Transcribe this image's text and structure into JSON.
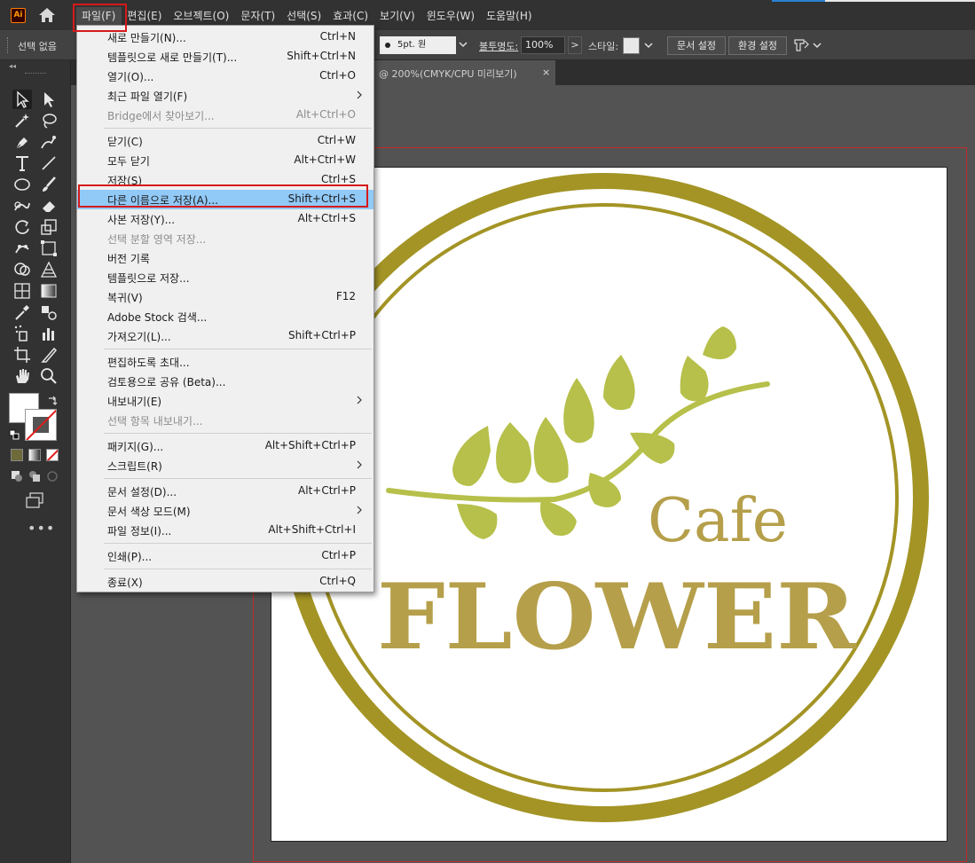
{
  "menubar": {
    "app_logo": "Ai",
    "items": [
      {
        "label": "파일(F)",
        "open": true
      },
      {
        "label": "편집(E)"
      },
      {
        "label": "오브젝트(O)"
      },
      {
        "label": "문자(T)"
      },
      {
        "label": "선택(S)"
      },
      {
        "label": "효과(C)"
      },
      {
        "label": "보기(V)"
      },
      {
        "label": "윈도우(W)"
      },
      {
        "label": "도움말(H)"
      }
    ]
  },
  "controlbar": {
    "selection_label": "선택 없음",
    "stroke_value": "5pt. 원",
    "opacity_label": "불투명도:",
    "opacity_value": "100%",
    "opacity_arrow": ">",
    "style_label": "스타일:",
    "doc_setup_label": "문서 설정",
    "preferences_label": "환경 설정"
  },
  "toolbar": {
    "collapse_glyph": "◂◂",
    "more_glyph": "•••",
    "tools": [
      "selection-tool-icon",
      "direct-selection-tool-icon",
      "magic-wand-tool-icon",
      "lasso-tool-icon",
      "pen-tool-icon",
      "curvature-tool-icon",
      "type-tool-icon",
      "line-segment-tool-icon",
      "ellipse-tool-icon",
      "paintbrush-tool-icon",
      "shaper-tool-icon",
      "eraser-tool-icon",
      "rotate-tool-icon",
      "scale-tool-icon",
      "puppet-warp-tool-icon",
      "free-transform-tool-icon",
      "shape-builder-tool-icon",
      "perspective-grid-tool-icon",
      "mesh-tool-icon",
      "gradient-tool-icon",
      "eyedropper-tool-icon",
      "blend-tool-icon",
      "symbol-sprayer-tool-icon",
      "column-graph-tool-icon",
      "artboard-tool-icon",
      "slice-tool-icon",
      "hand-tool-icon",
      "zoom-tool-icon"
    ]
  },
  "document_tab": {
    "title": "@ 200%(CMYK/CPU 미리보기)",
    "close": "×"
  },
  "artwork": {
    "word_small": "Cafe",
    "word_large": "FLOWER",
    "colors": {
      "ring": "#a39425",
      "leaf": "#b6c04a",
      "text": "#b59f4a"
    }
  },
  "file_menu": {
    "items": [
      {
        "label": "새로 만들기(N)...",
        "shortcut": "Ctrl+N"
      },
      {
        "label": "템플릿으로 새로 만들기(T)...",
        "shortcut": "Shift+Ctrl+N"
      },
      {
        "label": "열기(O)...",
        "shortcut": "Ctrl+O"
      },
      {
        "label": "최근 파일 열기(F)",
        "shortcut": "",
        "submenu": true
      },
      {
        "label": "Bridge에서 찾아보기...",
        "shortcut": "Alt+Ctrl+O",
        "disabled": true
      },
      {
        "label": "닫기(C)",
        "shortcut": "Ctrl+W"
      },
      {
        "label": "모두 닫기",
        "shortcut": "Alt+Ctrl+W"
      },
      {
        "label": "저장(S)",
        "shortcut": "Ctrl+S"
      },
      {
        "label": "다른 이름으로 저장(A)...",
        "shortcut": "Shift+Ctrl+S",
        "highlighted": true
      },
      {
        "label": "사본 저장(Y)...",
        "shortcut": "Alt+Ctrl+S"
      },
      {
        "label": "선택 분할 영역 저장...",
        "shortcut": "",
        "disabled": true
      },
      {
        "label": "버전 기록",
        "shortcut": ""
      },
      {
        "label": "템플릿으로 저장...",
        "shortcut": ""
      },
      {
        "label": "복귀(V)",
        "shortcut": "F12"
      },
      {
        "label": "Adobe Stock 검색...",
        "shortcut": ""
      },
      {
        "label": "가져오기(L)...",
        "shortcut": "Shift+Ctrl+P"
      },
      {
        "label": "편집하도록 초대...",
        "shortcut": ""
      },
      {
        "label": "검토용으로 공유 (Beta)...",
        "shortcut": ""
      },
      {
        "label": "내보내기(E)",
        "shortcut": "",
        "submenu": true
      },
      {
        "label": "선택 항목 내보내기...",
        "shortcut": "",
        "disabled": true
      },
      {
        "label": "패키지(G)...",
        "shortcut": "Alt+Shift+Ctrl+P"
      },
      {
        "label": "스크립트(R)",
        "shortcut": "",
        "submenu": true
      },
      {
        "label": "문서 설정(D)...",
        "shortcut": "Alt+Ctrl+P"
      },
      {
        "label": "문서 색상 모드(M)",
        "shortcut": "",
        "submenu": true
      },
      {
        "label": "파일 정보(I)...",
        "shortcut": "Alt+Shift+Ctrl+I"
      },
      {
        "label": "인쇄(P)...",
        "shortcut": "Ctrl+P"
      },
      {
        "label": "종료(X)",
        "shortcut": "Ctrl+Q"
      }
    ]
  }
}
